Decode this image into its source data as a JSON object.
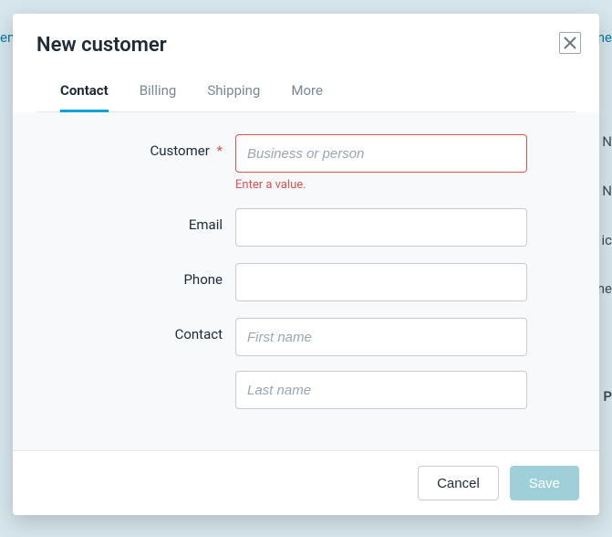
{
  "modal": {
    "title": "New customer",
    "tabs": [
      {
        "label": "Contact",
        "active": true
      },
      {
        "label": "Billing",
        "active": false
      },
      {
        "label": "Shipping",
        "active": false
      },
      {
        "label": "More",
        "active": false
      }
    ],
    "fields": {
      "customer": {
        "label": "Customer",
        "required_mark": "*",
        "placeholder": "Business or person",
        "value": "",
        "error": "Enter a value."
      },
      "email": {
        "label": "Email",
        "value": ""
      },
      "phone": {
        "label": "Phone",
        "value": ""
      },
      "contact_first": {
        "label": "Contact",
        "placeholder": "First name",
        "value": ""
      },
      "contact_last": {
        "placeholder": "Last name",
        "value": ""
      }
    },
    "footer": {
      "cancel": "Cancel",
      "save": "Save"
    }
  },
  "background": {
    "frag1": "en",
    "frag2": "ne",
    "frag3": "e N",
    "frag4": ". N",
    "frag5": "ic",
    "frag6": "me",
    "frag7": "P"
  }
}
